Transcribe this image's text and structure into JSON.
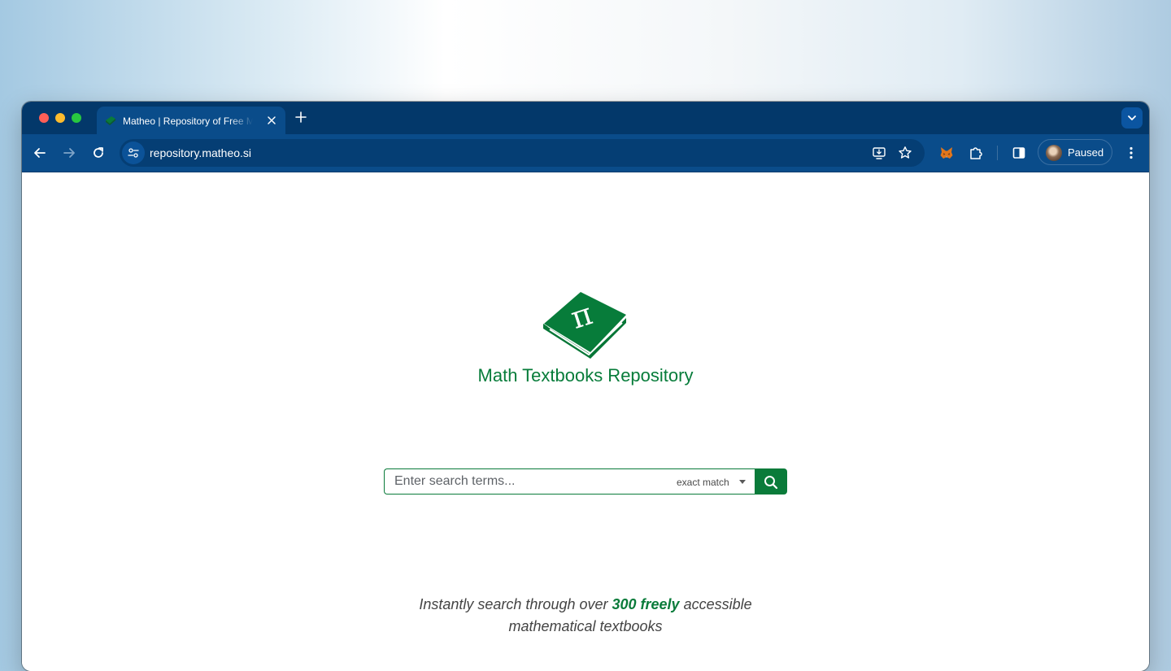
{
  "browser": {
    "tab": {
      "title": "Matheo | Repository of Free Mathematical Textbooks"
    },
    "address_bar": {
      "url": "repository.matheo.si"
    },
    "profile": {
      "label": "Paused"
    },
    "icons": [
      "back-icon",
      "forward-icon",
      "reload-icon",
      "site-info-icon",
      "install-app-icon",
      "bookmark-star-icon",
      "metamask-fox-icon",
      "extensions-puzzle-icon",
      "side-panel-icon",
      "kebab-menu-icon",
      "tab-search-chevron-icon",
      "new-tab-plus-icon",
      "tab-close-icon"
    ]
  },
  "page": {
    "site_title": "Math Textbooks Repository",
    "logo": {
      "icon": "pi-book-icon",
      "symbol": "π",
      "color": "#077c3a"
    },
    "search": {
      "placeholder": "Enter search terms...",
      "value": "",
      "match_mode": "exact match"
    },
    "tagline": {
      "part1": "Instantly search through over ",
      "highlight": "300 freely",
      "part2": " accessible",
      "line2": "mathematical textbooks"
    }
  },
  "colors": {
    "brand_green": "#0a7b3a",
    "chrome_dark": "#03386a",
    "chrome_toolbar": "#0a4c8a"
  }
}
